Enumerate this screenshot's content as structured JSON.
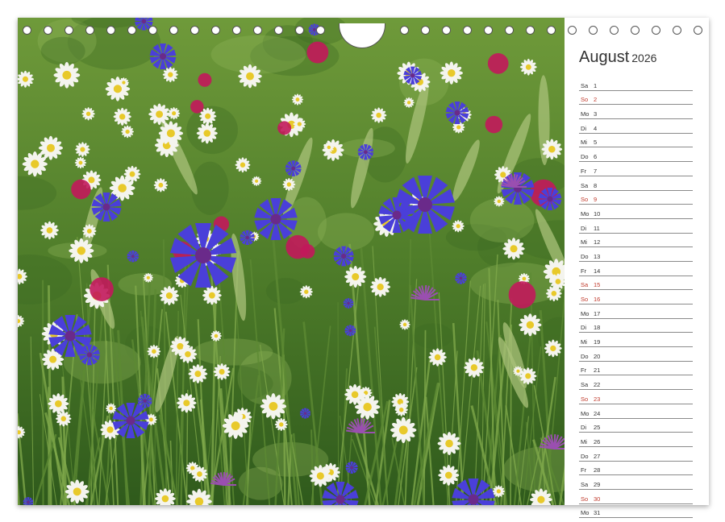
{
  "calendar": {
    "month": "August",
    "year": "2026",
    "days": [
      {
        "wd": "Sa",
        "d": "1",
        "red": false
      },
      {
        "wd": "So",
        "d": "2",
        "red": true
      },
      {
        "wd": "Mo",
        "d": "3",
        "red": false
      },
      {
        "wd": "Di",
        "d": "4",
        "red": false
      },
      {
        "wd": "Mi",
        "d": "5",
        "red": false
      },
      {
        "wd": "Do",
        "d": "6",
        "red": false
      },
      {
        "wd": "Fr",
        "d": "7",
        "red": false
      },
      {
        "wd": "Sa",
        "d": "8",
        "red": false
      },
      {
        "wd": "So",
        "d": "9",
        "red": true
      },
      {
        "wd": "Mo",
        "d": "10",
        "red": false
      },
      {
        "wd": "Di",
        "d": "11",
        "red": false
      },
      {
        "wd": "Mi",
        "d": "12",
        "red": false
      },
      {
        "wd": "Do",
        "d": "13",
        "red": false
      },
      {
        "wd": "Fr",
        "d": "14",
        "red": false
      },
      {
        "wd": "Sa",
        "d": "15",
        "red": true
      },
      {
        "wd": "So",
        "d": "16",
        "red": true
      },
      {
        "wd": "Mo",
        "d": "17",
        "red": false
      },
      {
        "wd": "Di",
        "d": "18",
        "red": false
      },
      {
        "wd": "Mi",
        "d": "19",
        "red": false
      },
      {
        "wd": "Do",
        "d": "20",
        "red": false
      },
      {
        "wd": "Fr",
        "d": "21",
        "red": false
      },
      {
        "wd": "Sa",
        "d": "22",
        "red": false
      },
      {
        "wd": "So",
        "d": "23",
        "red": true
      },
      {
        "wd": "Mo",
        "d": "24",
        "red": false
      },
      {
        "wd": "Di",
        "d": "25",
        "red": false
      },
      {
        "wd": "Mi",
        "d": "26",
        "red": false
      },
      {
        "wd": "Do",
        "d": "27",
        "red": false
      },
      {
        "wd": "Fr",
        "d": "28",
        "red": false
      },
      {
        "wd": "Sa",
        "d": "29",
        "red": false
      },
      {
        "wd": "So",
        "d": "30",
        "red": true
      },
      {
        "wd": "Mo",
        "d": "31",
        "red": false
      }
    ]
  },
  "colors": {
    "weekend_text": "#c0392b",
    "grid_line": "#8a8a8a",
    "meadow_green": "#4f7d2a",
    "cornflower_blue": "#4a3fd9",
    "poppy_red": "#c2185b",
    "chamomile_white": "#f4f4ee",
    "chamomile_center": "#e8c92a"
  },
  "photo": {
    "subject": "wildflower-meadow"
  }
}
